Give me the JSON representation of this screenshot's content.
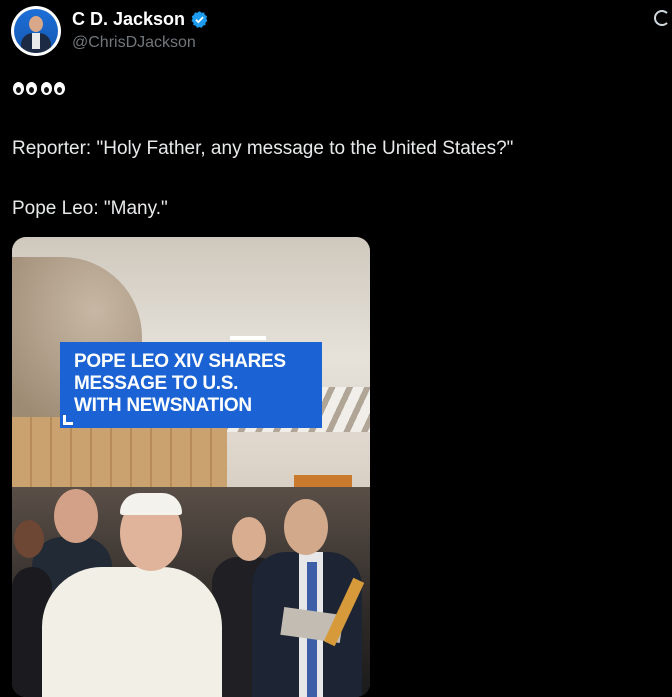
{
  "author": {
    "display_name": "C   D. Jackson",
    "handle": "@ChrisDJackson",
    "verified": true,
    "avatar": "avatar-portrait"
  },
  "tweet": {
    "emoji": "eyes-emoji",
    "line1": "Reporter: \"Holy Father, any message to the United States?\"",
    "line2": "Pope Leo: \"Many.\""
  },
  "media": {
    "banner_lines": [
      "POPE LEO XIV SHARES",
      "MESSAGE TO U.S.",
      "WITH NEWSNATION"
    ],
    "banner_color": "#1b63d4"
  },
  "colors": {
    "background": "#000000",
    "text": "#e7e9ea",
    "secondary_text": "#71767b",
    "verified_badge": "#1d9bf0"
  }
}
